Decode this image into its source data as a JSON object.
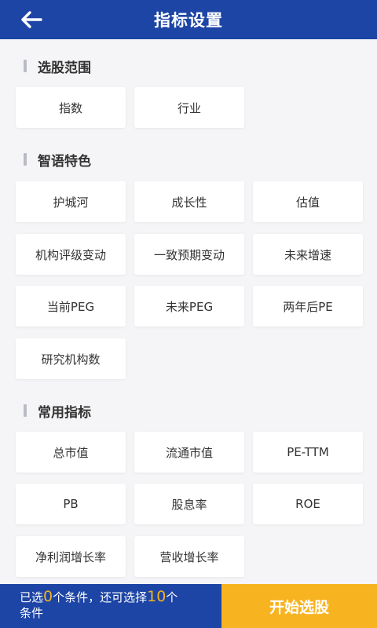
{
  "header": {
    "title": "指标设置"
  },
  "sections": [
    {
      "title": "选股范围",
      "items": [
        "指数",
        "行业"
      ]
    },
    {
      "title": "智语特色",
      "items": [
        "护城河",
        "成长性",
        "估值",
        "机构评级变动",
        "一致预期变动",
        "未来增速",
        "当前PEG",
        "未来PEG",
        "两年后PE",
        "研究机构数"
      ]
    },
    {
      "title": "常用指标",
      "items": [
        "总市值",
        "流通市值",
        "PE-TTM",
        "PB",
        "股息率",
        "ROE",
        "净利润增长率",
        "营收增长率"
      ]
    }
  ],
  "footer": {
    "text_part1": "已选",
    "selected_count": "0",
    "text_part2": "个条件，还可选择",
    "remaining_count": "10",
    "text_part3": "个",
    "text_part4": "条件",
    "start_button": "开始选股"
  },
  "colors": {
    "header_bg": "#1d45a6",
    "accent": "#f8b321",
    "count_highlight": "#f6b31c"
  },
  "icons": {
    "back": "arrow-left-icon"
  }
}
